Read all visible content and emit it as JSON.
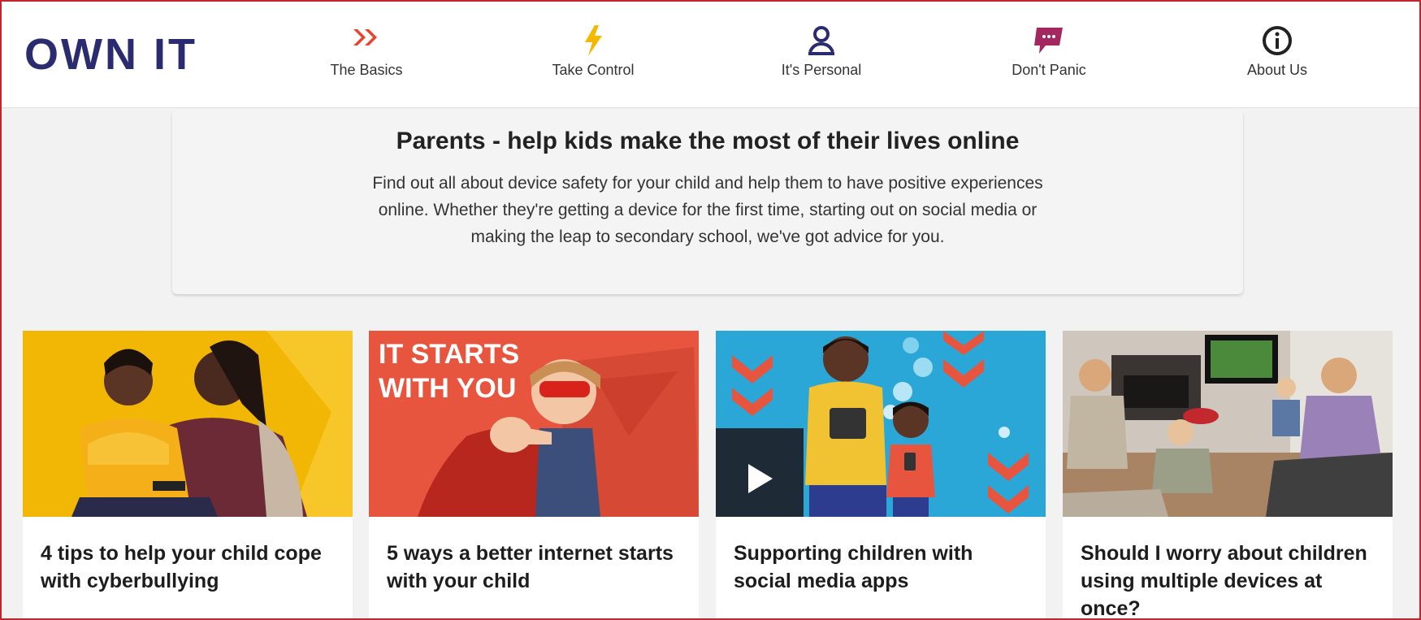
{
  "header": {
    "logo": "OWN IT",
    "nav": [
      {
        "label": "The Basics",
        "icon": "double-chevron-icon",
        "color": "#e8432f"
      },
      {
        "label": "Take Control",
        "icon": "lightning-icon",
        "color": "#f5b800"
      },
      {
        "label": "It's Personal",
        "icon": "person-icon",
        "color": "#2b2b6f"
      },
      {
        "label": "Don't Panic",
        "icon": "speech-bubble-icon",
        "color": "#a3285f"
      },
      {
        "label": "About Us",
        "icon": "info-icon",
        "color": "#222222"
      }
    ]
  },
  "intro": {
    "heading": "Parents - help kids make the most of their lives online",
    "body": "Find out all about device safety for your child and help them to have positive experiences online. Whether they're getting a device for the first time, starting out on social media or making the leap to secondary school, we've got advice for you."
  },
  "cards": [
    {
      "title": "4 tips to help your child cope with cyberbullying",
      "image": "mother-and-child-with-phone"
    },
    {
      "title": "5 ways a better internet starts with your child",
      "image": "child-superhero-it-starts-with-you",
      "overlay_text": "IT STARTS WITH YOU"
    },
    {
      "title": "Supporting children with social media apps",
      "image": "illustrated-kids-with-devices",
      "has_video": true
    },
    {
      "title": "Should I worry about children using multiple devices at once?",
      "image": "family-living-room-devices"
    }
  ],
  "colors": {
    "brand": "#2b2b6f",
    "frame": "#c0262d",
    "card_yellow": "#f2b705",
    "card_red": "#e8553f",
    "card_blue": "#2aa7d6"
  }
}
